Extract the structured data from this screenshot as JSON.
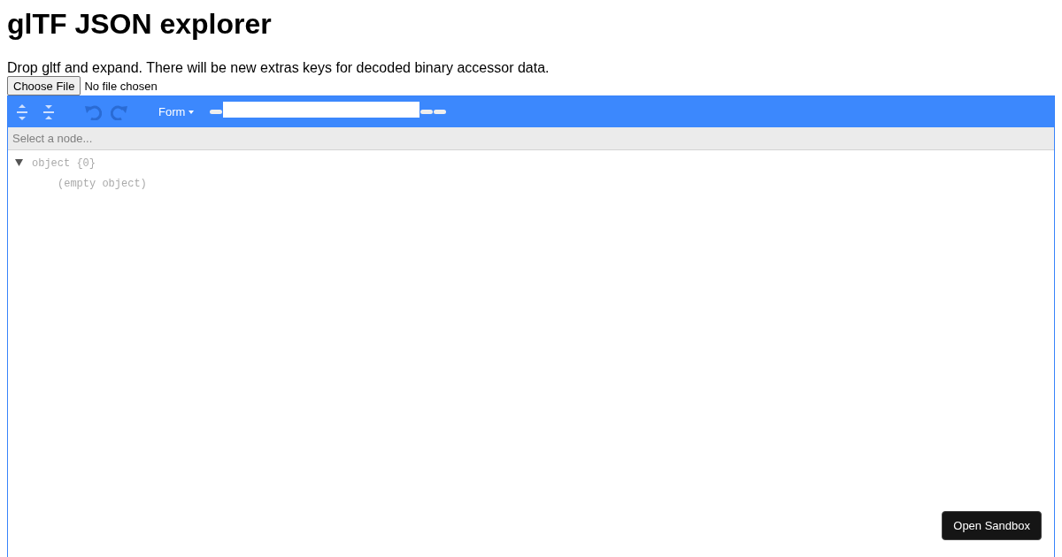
{
  "title": "glTF JSON explorer",
  "description": "Drop gltf and expand. There will be new extras keys for decoded binary accessor data.",
  "file_input": {
    "button": "Choose File",
    "status": "No file chosen"
  },
  "toolbar": {
    "undo_disabled": true,
    "redo_disabled": true,
    "mode": "Form"
  },
  "navbar": {
    "placeholder": "Select a node..."
  },
  "tree": {
    "label": "object {0}",
    "expanded": true,
    "empty_text": "(empty object)"
  },
  "sandbox_button": "Open Sandbox"
}
